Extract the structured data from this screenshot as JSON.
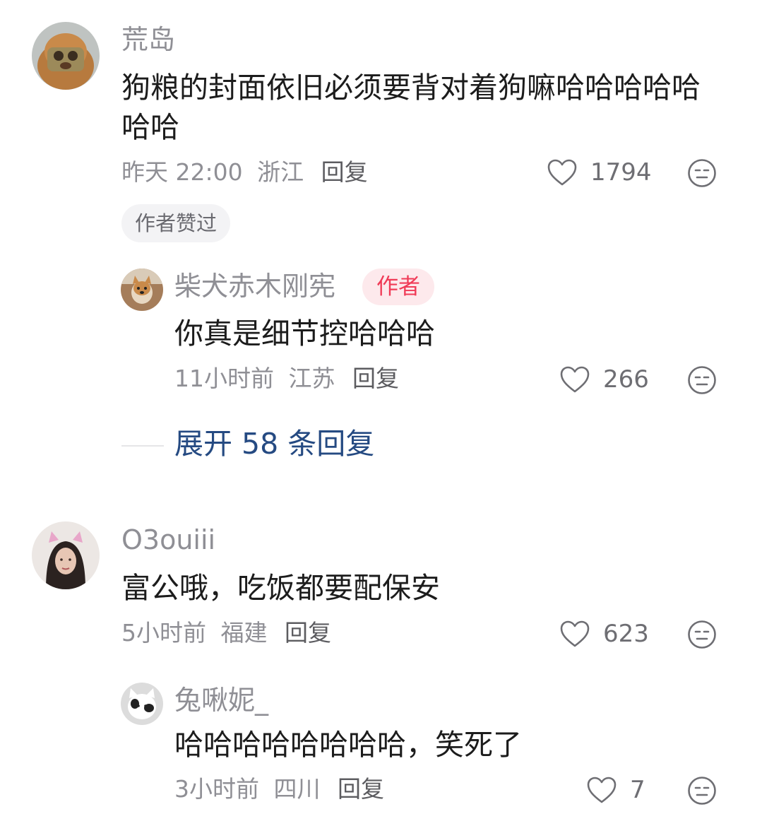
{
  "comments": [
    {
      "username": "荒岛",
      "content": "狗粮的封面依旧必须要背对着狗嘛哈哈哈哈哈哈哈",
      "time": "昨天 22:00",
      "location": "浙江",
      "reply_label": "回复",
      "likes": "1794",
      "badge": "作者赞过",
      "reply": {
        "username": "柴犬赤木刚宪",
        "tag": "作者",
        "content": "你真是细节控哈哈哈",
        "time": "11小时前",
        "location": "江苏",
        "reply_label": "回复",
        "likes": "266"
      },
      "expand_label": "展开 58 条回复"
    },
    {
      "username": "O3ouiii",
      "content": "富公哦，吃饭都要配保安",
      "time": "5小时前",
      "location": "福建",
      "reply_label": "回复",
      "likes": "623",
      "reply": {
        "username": "兔啾妮_",
        "content": "哈哈哈哈哈哈哈哈，笑死了",
        "time": "3小时前",
        "location": "四川",
        "reply_label": "回复",
        "likes": "7"
      }
    }
  ],
  "icons": {
    "like": "heart-outline-icon",
    "dislike": "meh-face-icon"
  },
  "colors": {
    "author_tag_text": "#f03b57",
    "author_tag_bg": "#fde9ec",
    "expand_link": "#254a82",
    "meta_text": "#8f8f95"
  }
}
